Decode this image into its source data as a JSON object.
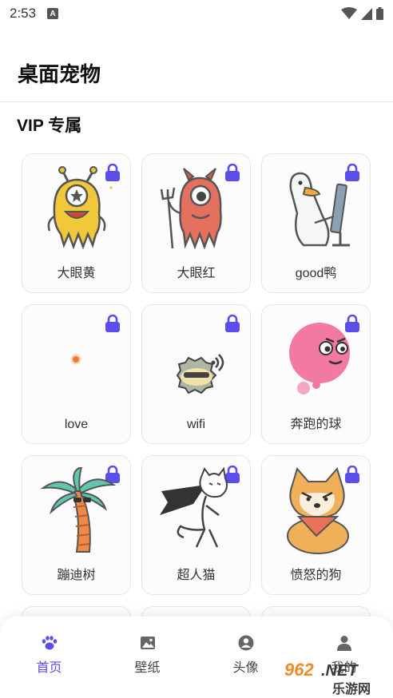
{
  "status_bar": {
    "time": "2:53",
    "notification_icon": "a-icon"
  },
  "header": {
    "title": "桌面宠物"
  },
  "section": {
    "title": "VIP 专属"
  },
  "pets": [
    {
      "name": "大眼黄",
      "locked": true,
      "art": "yellow-one-eyed-monster-icon"
    },
    {
      "name": "大眼红",
      "locked": true,
      "art": "red-one-eyed-devil-octopus-icon"
    },
    {
      "name": "good鸭",
      "locked": true,
      "art": "duck-at-computer-icon"
    },
    {
      "name": "love",
      "locked": true,
      "art": "small-orange-dot-icon"
    },
    {
      "name": "wifi",
      "locked": true,
      "art": "wifi-fuzzball-icon"
    },
    {
      "name": "奔跑的球",
      "locked": true,
      "art": "pink-ball-face-icon"
    },
    {
      "name": "蹦迪树",
      "locked": true,
      "art": "palm-tree-sunglasses-icon"
    },
    {
      "name": "超人猫",
      "locked": true,
      "art": "superhero-cat-icon"
    },
    {
      "name": "愤怒的狗",
      "locked": true,
      "art": "angry-shiba-dog-icon"
    }
  ],
  "tabs": [
    {
      "label": "首页",
      "icon": "paw-icon",
      "active": true
    },
    {
      "label": "壁纸",
      "icon": "image-icon",
      "active": false
    },
    {
      "label": "头像",
      "icon": "avatar-circle-icon",
      "active": false
    },
    {
      "label": "我的",
      "icon": "person-icon",
      "active": false
    }
  ],
  "colors": {
    "accent": "#5b4de8",
    "lock": "#5b4de8"
  },
  "watermark": {
    "text_top": "962.NET",
    "text_bottom": "乐游网"
  }
}
